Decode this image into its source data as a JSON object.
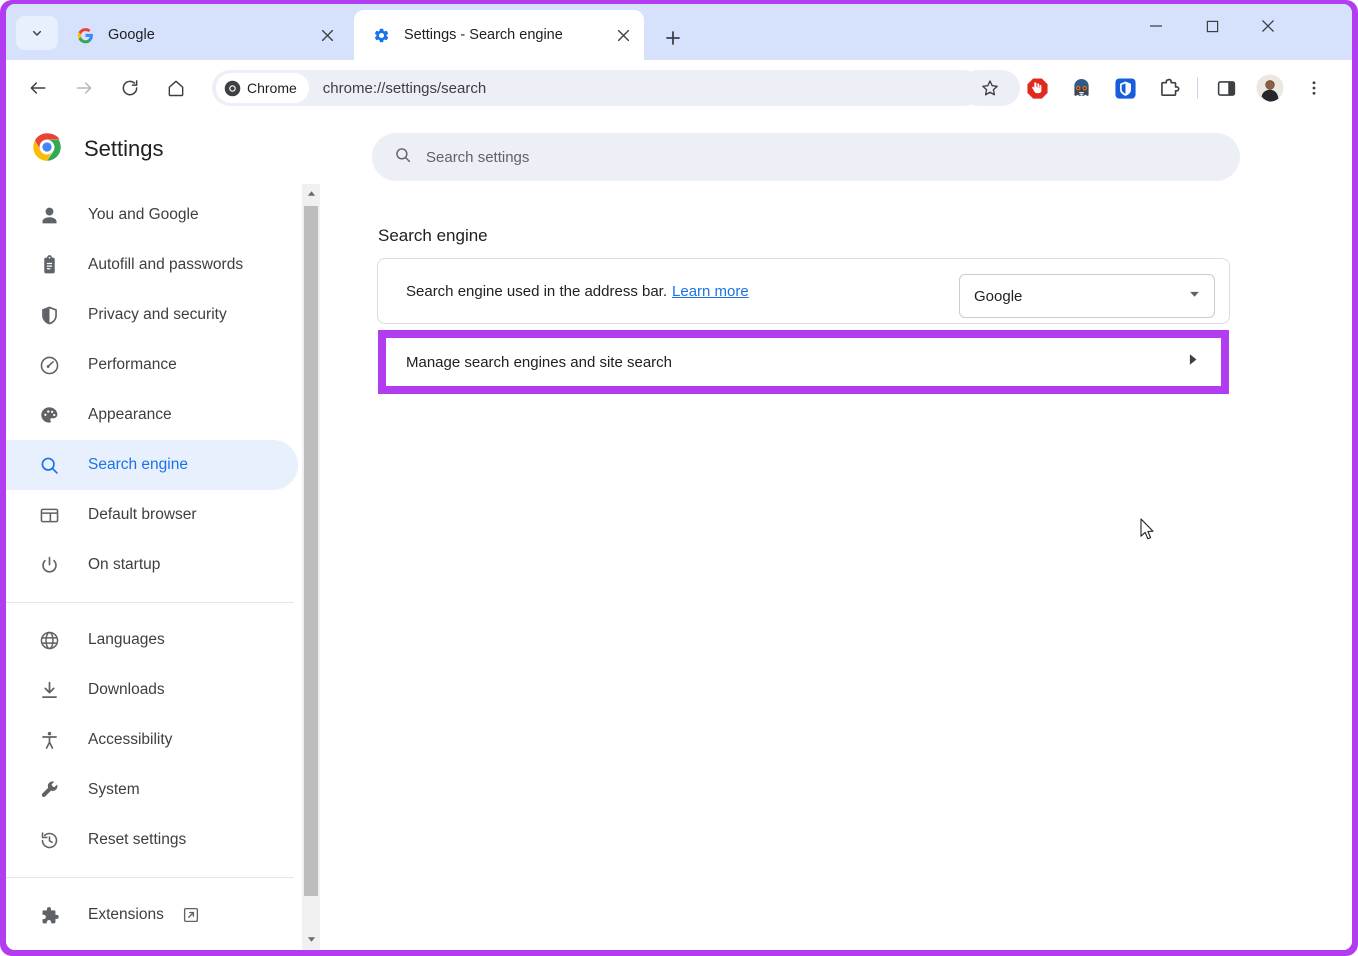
{
  "window": {
    "controls": {
      "minimize": "Minimize",
      "maximize": "Maximize",
      "close": "Close"
    },
    "highlight_color": "#b23df0"
  },
  "tabstrip": {
    "tab_search_label": "Search tabs",
    "new_tab_label": "New Tab",
    "tabs": [
      {
        "title": "Google",
        "favicon": "google-icon",
        "active": false,
        "close_label": "Close tab"
      },
      {
        "title": "Settings - Search engine",
        "favicon": "gear-icon",
        "active": true,
        "close_label": "Close tab"
      }
    ]
  },
  "toolbar": {
    "back_label": "Back",
    "forward_label": "Forward",
    "reload_label": "Reload",
    "home_label": "Home",
    "omnibox": {
      "chip_label": "Chrome",
      "url": "chrome://settings/search"
    },
    "bookmark_label": "Bookmark this tab",
    "extensions": [
      {
        "name": "adblock-icon",
        "title": "AdBlock"
      },
      {
        "name": "ghostery-icon",
        "title": "Ghostery"
      },
      {
        "name": "bitwarden-icon",
        "title": "Bitwarden"
      },
      {
        "name": "extensions-puzzle-icon",
        "title": "Extensions"
      },
      {
        "name": "side-panel-icon",
        "title": "Side panel"
      },
      {
        "name": "profile-avatar",
        "title": "Profile"
      },
      {
        "name": "three-dot-menu-icon",
        "title": "Customize and control Google Chrome"
      }
    ]
  },
  "sidebar": {
    "title": "Settings",
    "logo": "chrome-logo-icon",
    "items": [
      {
        "label": "You and Google",
        "icon": "person-icon",
        "selected": false
      },
      {
        "label": "Autofill and passwords",
        "icon": "clipboard-icon",
        "selected": false
      },
      {
        "label": "Privacy and security",
        "icon": "shield-icon",
        "selected": false
      },
      {
        "label": "Performance",
        "icon": "speedometer-icon",
        "selected": false
      },
      {
        "label": "Appearance",
        "icon": "palette-icon",
        "selected": false
      },
      {
        "label": "Search engine",
        "icon": "search-icon",
        "selected": true
      },
      {
        "label": "Default browser",
        "icon": "browser-window-icon",
        "selected": false
      },
      {
        "label": "On startup",
        "icon": "power-icon",
        "selected": false
      }
    ],
    "items_group2": [
      {
        "label": "Languages",
        "icon": "globe-icon",
        "selected": false
      },
      {
        "label": "Downloads",
        "icon": "download-icon",
        "selected": false
      },
      {
        "label": "Accessibility",
        "icon": "accessibility-icon",
        "selected": false
      },
      {
        "label": "System",
        "icon": "wrench-icon",
        "selected": false
      },
      {
        "label": "Reset settings",
        "icon": "history-restore-icon",
        "selected": false
      }
    ],
    "items_group3": [
      {
        "label": "Extensions",
        "icon": "puzzle-piece-icon",
        "external": true,
        "selected": false
      }
    ]
  },
  "main": {
    "search": {
      "placeholder": "Search settings",
      "icon": "search-icon"
    },
    "section_title": "Search engine",
    "rows": [
      {
        "label": "Search engine used in the address bar.",
        "link_label": "Learn more",
        "control": "dropdown",
        "selected_value": "Google"
      },
      {
        "label": "Manage search engines and site search",
        "control": "chevron-right",
        "highlighted": true
      }
    ]
  },
  "scrollbar": {
    "up_label": "Scroll up",
    "down_label": "Scroll down"
  }
}
